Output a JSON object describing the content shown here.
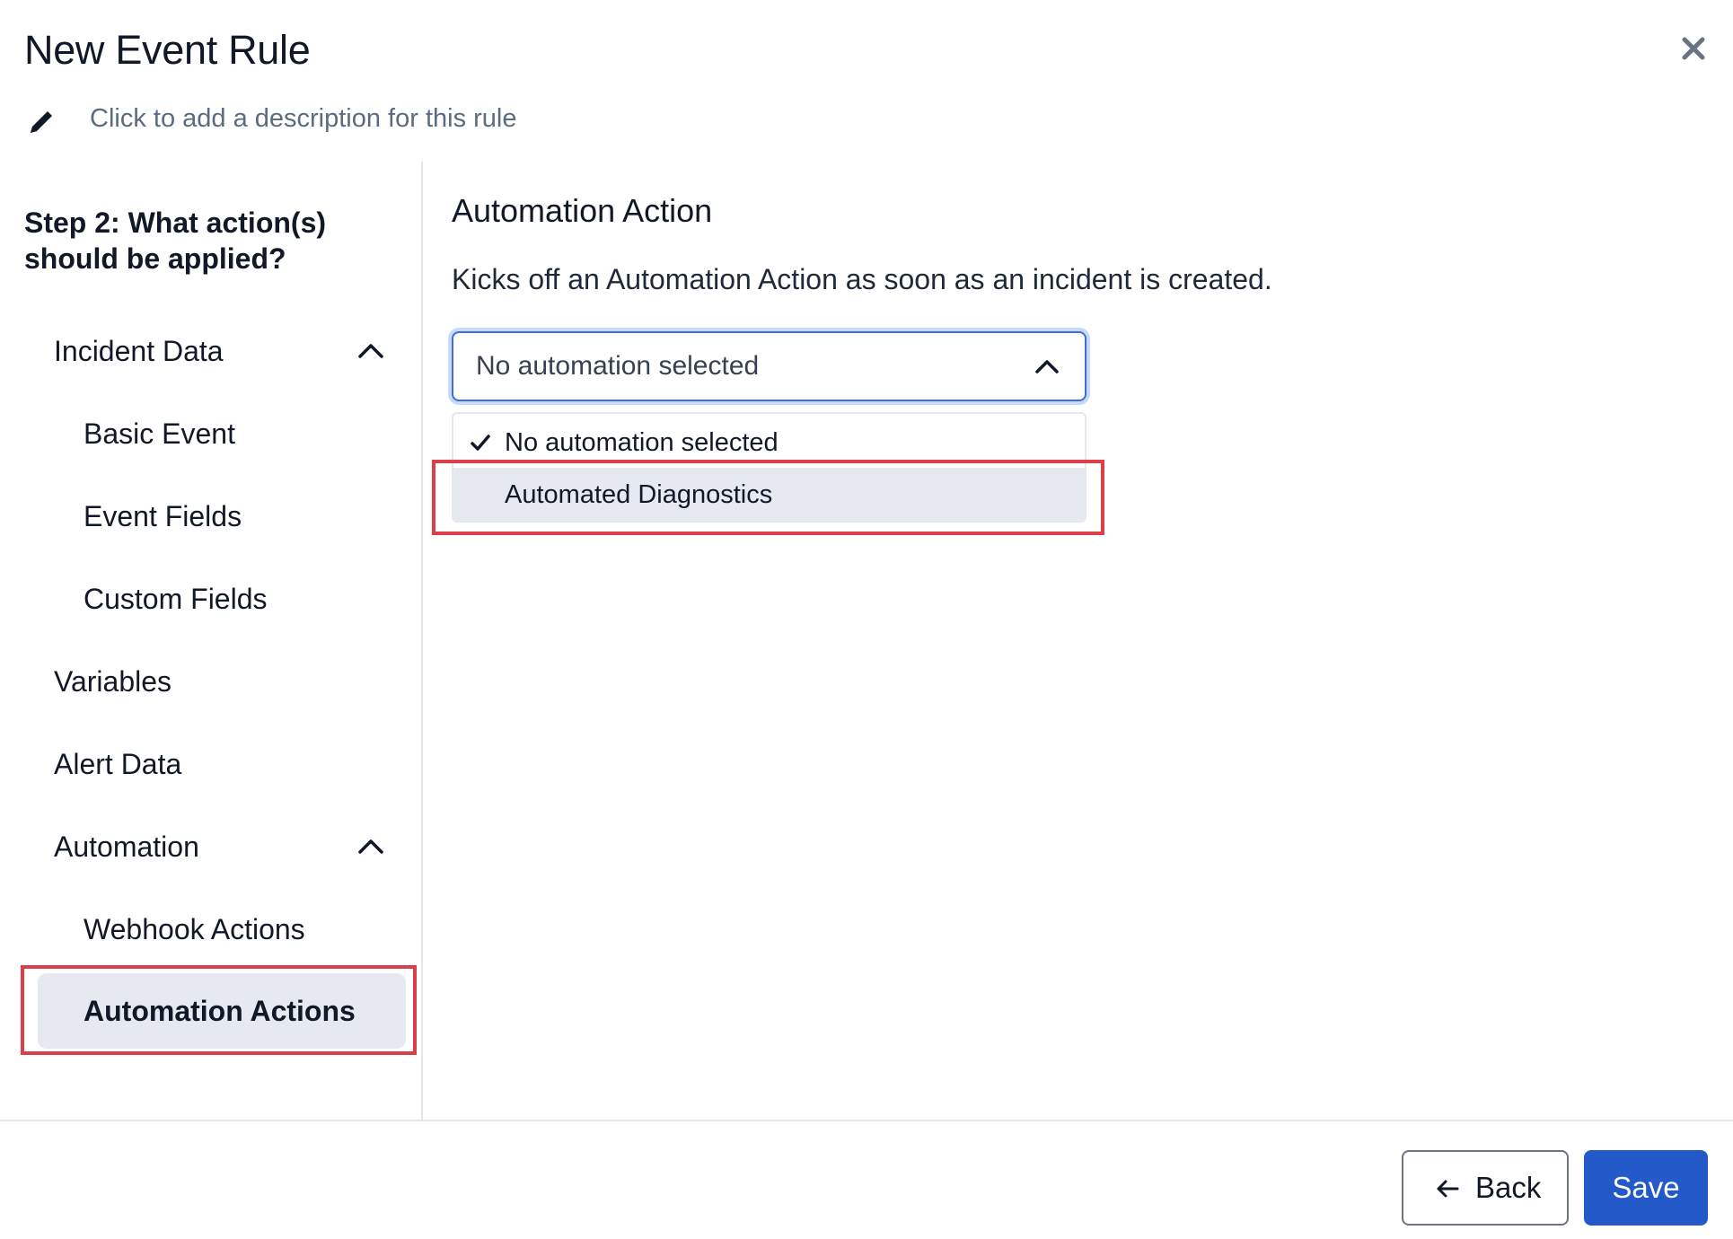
{
  "dialog": {
    "title": "New Event Rule",
    "description_placeholder": "Click to add a description for this rule"
  },
  "sidebar": {
    "step_title": "Step 2: What action(s) should be applied?",
    "items": [
      {
        "label": "Incident Data",
        "level": 1,
        "expanded": true
      },
      {
        "label": "Basic Event",
        "level": 2
      },
      {
        "label": "Event Fields",
        "level": 2
      },
      {
        "label": "Custom Fields",
        "level": 2
      },
      {
        "label": "Variables",
        "level": 1
      },
      {
        "label": "Alert Data",
        "level": 1
      },
      {
        "label": "Automation",
        "level": 1,
        "expanded": true
      },
      {
        "label": "Webhook Actions",
        "level": 2
      },
      {
        "label": "Automation Actions",
        "level": 2,
        "active": true
      }
    ]
  },
  "main": {
    "section_title": "Automation Action",
    "section_description": "Kicks off an Automation Action as soon as an incident is created.",
    "select": {
      "value": "No automation selected",
      "open": true,
      "options": [
        {
          "label": "No automation selected",
          "selected": true
        },
        {
          "label": "Automated Diagnostics",
          "selected": false,
          "hovered": true
        }
      ]
    }
  },
  "footer": {
    "back_label": "Back",
    "save_label": "Save"
  },
  "colors": {
    "primary": "#2459c9",
    "highlight_box": "#dc3f49",
    "active_bg": "#e6e9ef",
    "muted_text": "#5b6b82"
  },
  "icons": [
    "close-icon",
    "pencil-icon",
    "chevron-up-icon",
    "check-icon",
    "arrow-left-icon"
  ]
}
